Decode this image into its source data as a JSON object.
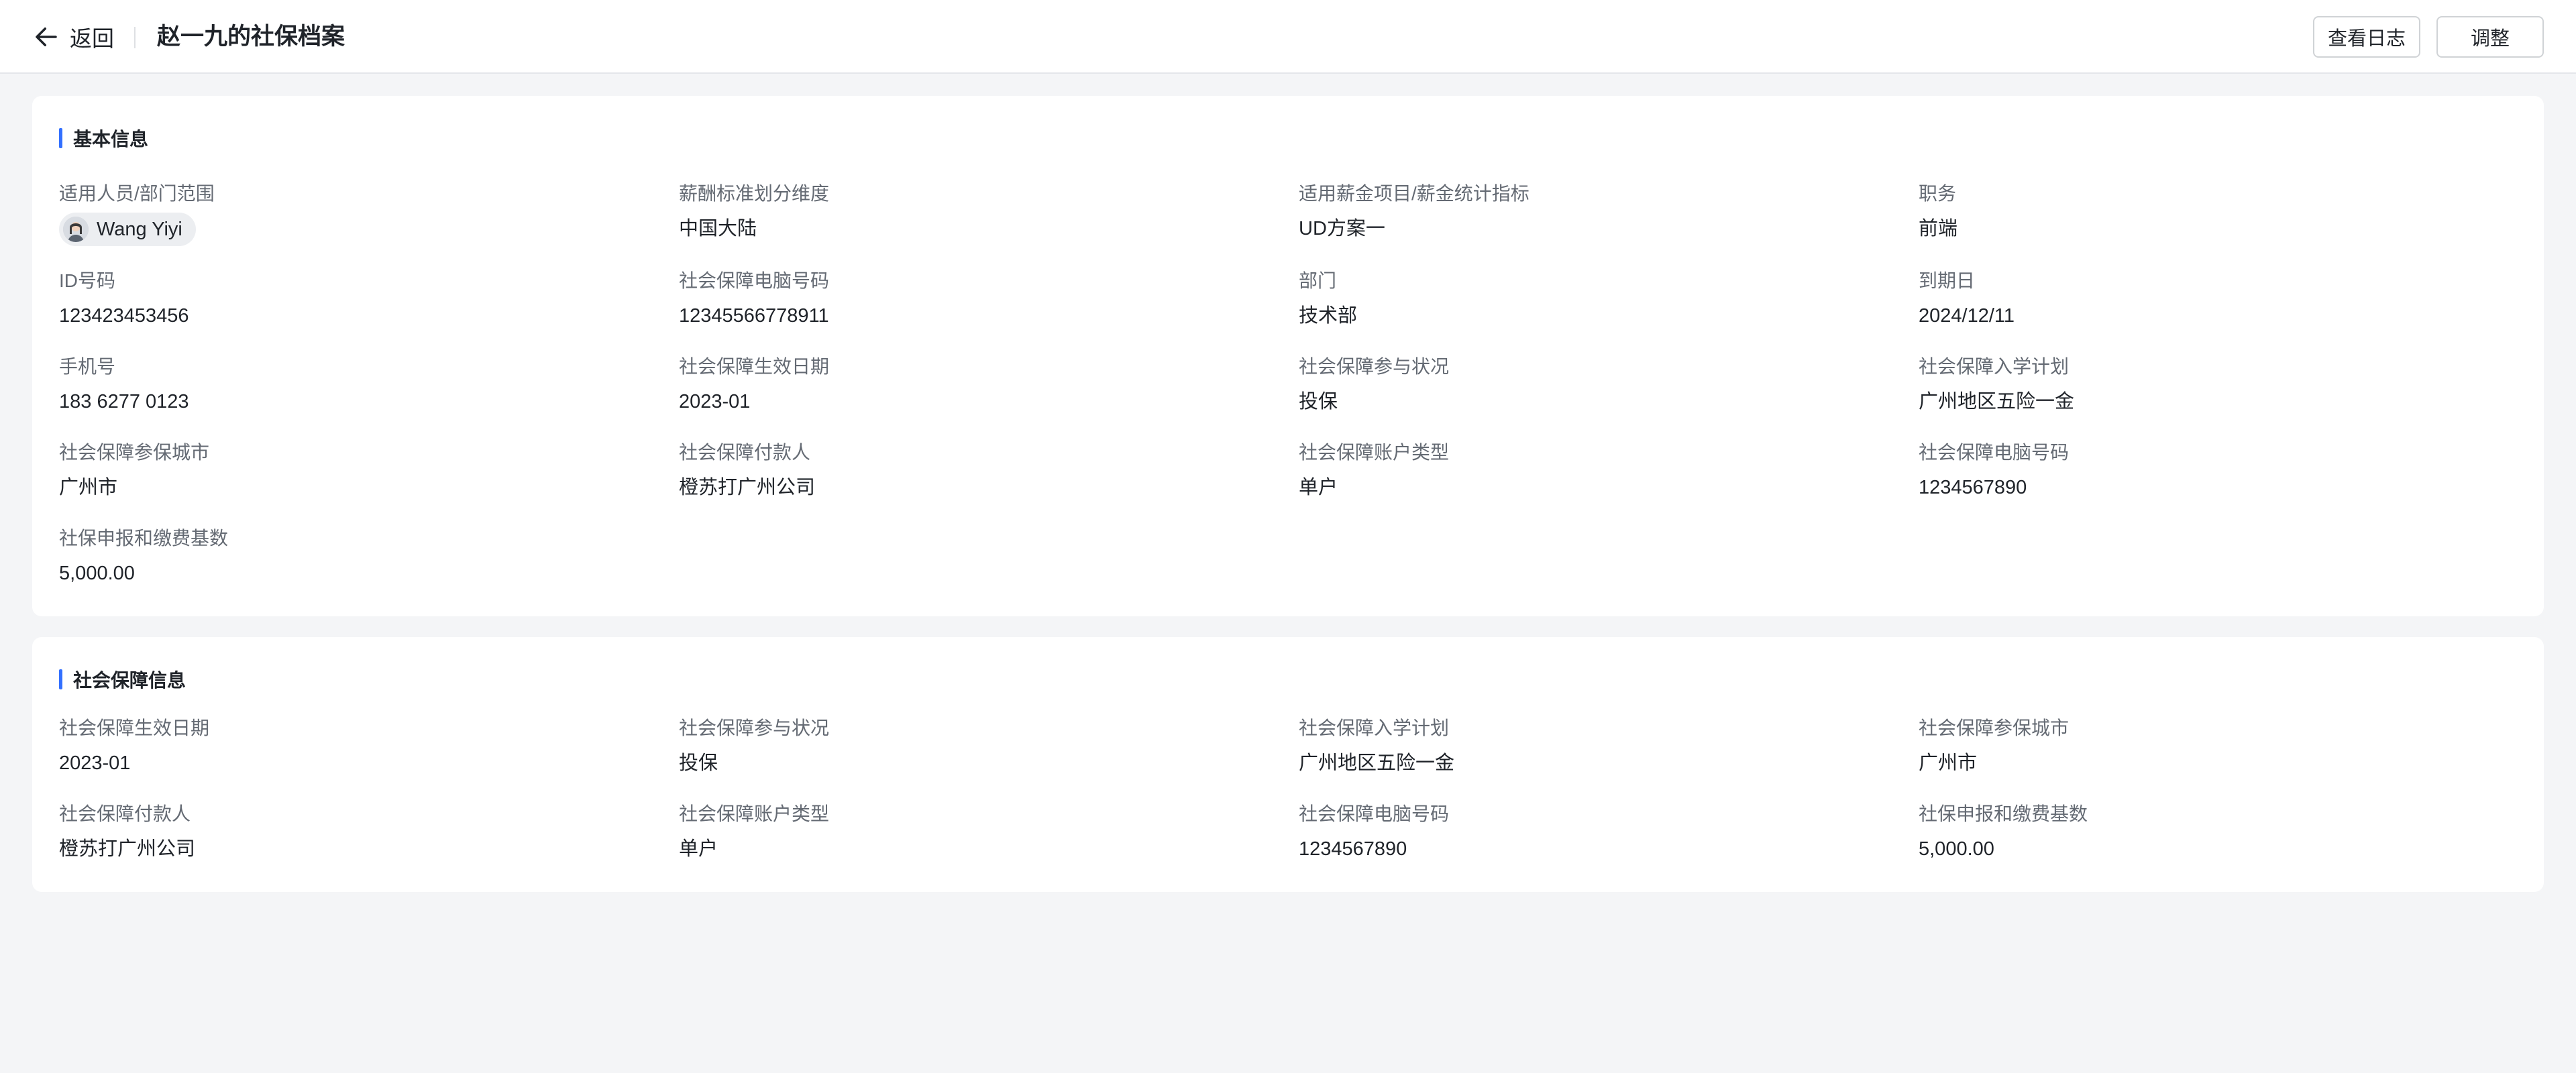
{
  "header": {
    "back_label": "返回",
    "title": "赵一九的社保档案",
    "view_log_label": "查看日志",
    "adjust_label": "调整"
  },
  "basic_info": {
    "title": "基本信息",
    "fields": [
      {
        "label": "适用人员/部门范围",
        "value": "Wang Yiyi"
      },
      {
        "label": "薪酬标准划分维度",
        "value": "中国大陆"
      },
      {
        "label": "适用薪金项目/薪金统计指标",
        "value": "UD方案一"
      },
      {
        "label": "职务",
        "value": "前端"
      },
      {
        "label": "ID号码",
        "value": "123423453456"
      },
      {
        "label": "社会保障电脑号码",
        "value": "12345566778911"
      },
      {
        "label": "部门",
        "value": "技术部"
      },
      {
        "label": "到期日",
        "value": "2024/12/11"
      },
      {
        "label": "手机号",
        "value": "183 6277 0123"
      },
      {
        "label": "社会保障生效日期",
        "value": "2023-01"
      },
      {
        "label": "社会保障参与状况",
        "value": "投保"
      },
      {
        "label": "社会保障入学计划",
        "value": "广州地区五险一金"
      },
      {
        "label": "社会保障参保城市",
        "value": "广州市"
      },
      {
        "label": "社会保障付款人",
        "value": "橙苏打广州公司"
      },
      {
        "label": "社会保障账户类型",
        "value": "单户"
      },
      {
        "label": "社会保障电脑号码",
        "value": "1234567890"
      },
      {
        "label": "社保申报和缴费基数",
        "value": "5,000.00"
      }
    ]
  },
  "social_info": {
    "title": "社会保障信息",
    "fields": [
      {
        "label": "社会保障生效日期",
        "value": "2023-01"
      },
      {
        "label": "社会保障参与状况",
        "value": "投保"
      },
      {
        "label": "社会保障入学计划",
        "value": "广州地区五险一金"
      },
      {
        "label": "社会保障参保城市",
        "value": "广州市"
      },
      {
        "label": "社会保障付款人",
        "value": "橙苏打广州公司"
      },
      {
        "label": "社会保障账户类型",
        "value": "单户"
      },
      {
        "label": "社会保障电脑号码",
        "value": "1234567890"
      },
      {
        "label": "社保申报和缴费基数",
        "value": "5,000.00"
      }
    ]
  },
  "colors": {
    "accent": "#3370ff",
    "background": "#f4f5f7",
    "label": "#646a73",
    "text": "#1f2329"
  }
}
